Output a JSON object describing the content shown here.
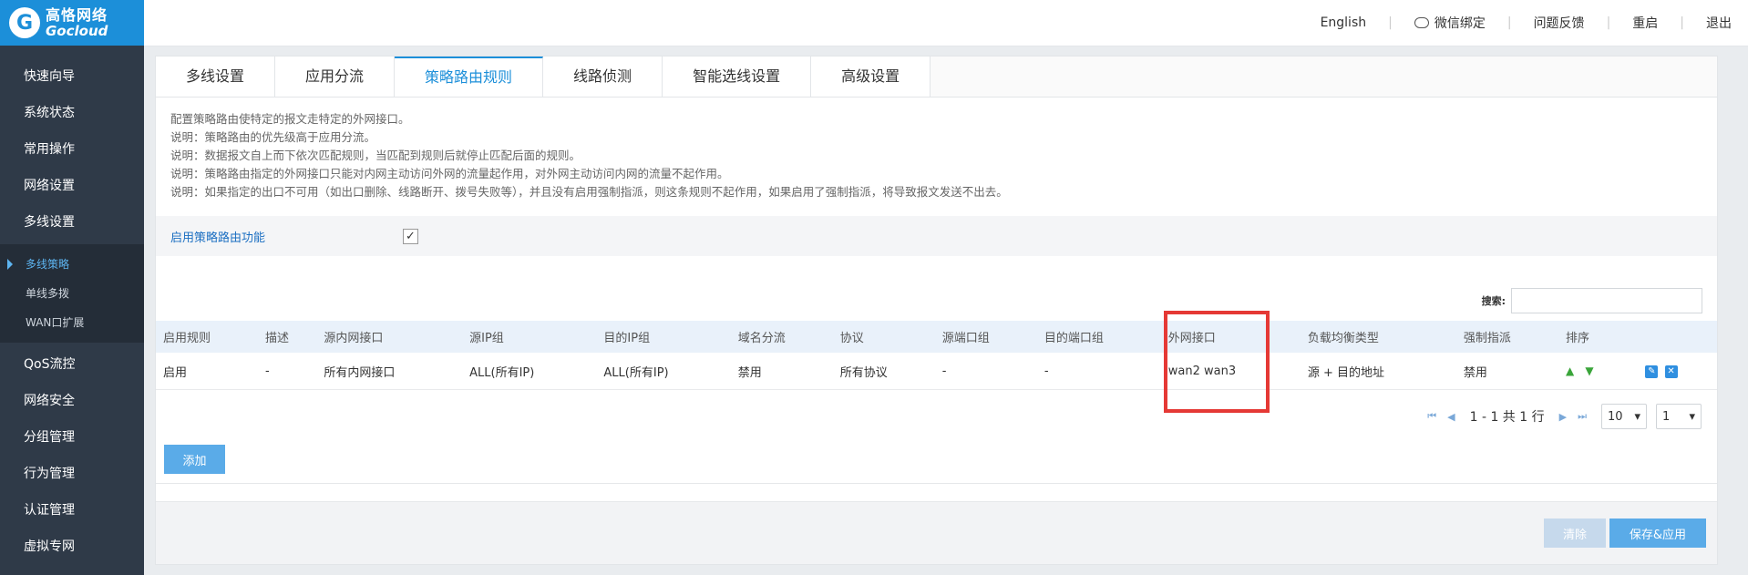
{
  "logo": {
    "cn": "高恪网络",
    "en": "Gocloud"
  },
  "header": {
    "english": "English",
    "wechat": "微信绑定",
    "feedback": "问题反馈",
    "reboot": "重启",
    "logout": "退出"
  },
  "sidebar": {
    "items": [
      {
        "label": "快速向导"
      },
      {
        "label": "系统状态"
      },
      {
        "label": "常用操作"
      },
      {
        "label": "网络设置"
      },
      {
        "label": "多线设置"
      }
    ],
    "subitems": [
      {
        "label": "多线策略"
      },
      {
        "label": "单线多拨"
      },
      {
        "label": "WAN口扩展"
      }
    ],
    "items2": [
      {
        "label": "QoS流控"
      },
      {
        "label": "网络安全"
      },
      {
        "label": "分组管理"
      },
      {
        "label": "行为管理"
      },
      {
        "label": "认证管理"
      },
      {
        "label": "虚拟专网"
      }
    ]
  },
  "tabs": [
    {
      "label": "多线设置"
    },
    {
      "label": "应用分流"
    },
    {
      "label": "策略路由规则"
    },
    {
      "label": "线路侦测"
    },
    {
      "label": "智能选线设置"
    },
    {
      "label": "高级设置"
    }
  ],
  "notes": [
    "配置策略路由使特定的报文走特定的外网接口。",
    "说明：策略路由的优先级高于应用分流。",
    "说明：数据报文自上而下依次匹配规则，当匹配到规则后就停止匹配后面的规则。",
    "说明：策略路由指定的外网接口只能对内网主动访问外网的流量起作用，对外网主动访问内网的流量不起作用。",
    "说明：如果指定的出口不可用（如出口删除、线路断开、拨号失败等），并且没有启用强制指派，则这条规则不起作用，如果启用了强制指派，将导致报文发送不出去。"
  ],
  "enable": {
    "label": "启用策略路由功能",
    "checked": true
  },
  "search": {
    "label": "搜索:",
    "value": ""
  },
  "table": {
    "headers": [
      "启用规则",
      "描述",
      "源内网接口",
      "源IP组",
      "目的IP组",
      "域名分流",
      "协议",
      "源端口组",
      "目的端口组",
      "外网接口",
      "负载均衡类型",
      "强制指派",
      "排序",
      ""
    ],
    "rows": [
      [
        "启用",
        "-",
        "所有内网接口",
        "ALL(所有IP)",
        "ALL(所有IP)",
        "禁用",
        "所有协议",
        "-",
        "-",
        "wan2 wan3",
        "源 + 目的地址",
        "禁用"
      ]
    ]
  },
  "pager": {
    "info": "1 - 1 共 1 行",
    "page_size": "10",
    "page": "1"
  },
  "buttons": {
    "add": "添加",
    "clear": "清除",
    "save": "保存&应用"
  }
}
